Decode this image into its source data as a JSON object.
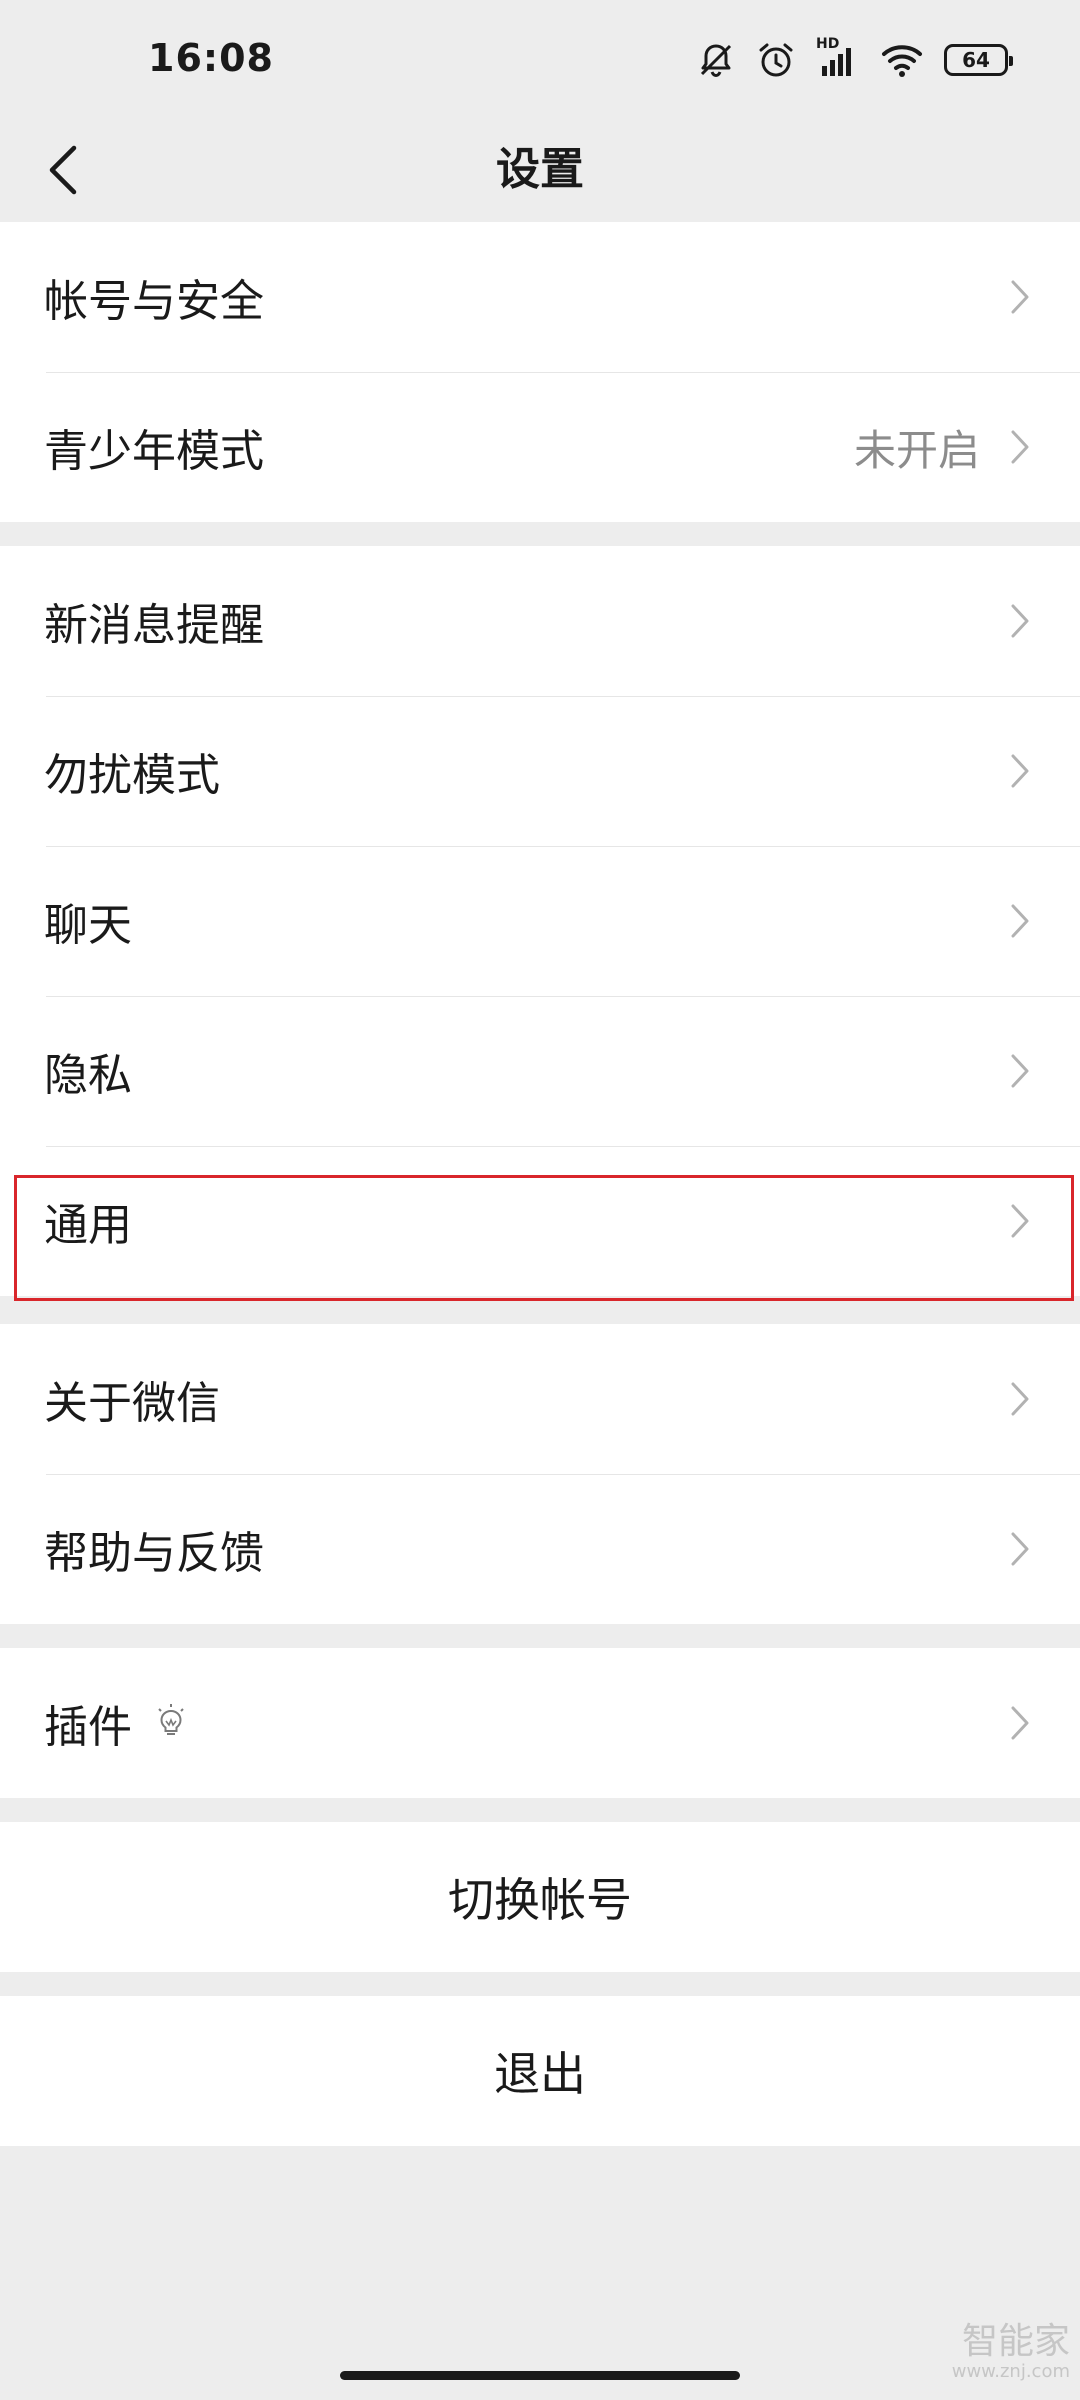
{
  "status_bar": {
    "time": "16:08",
    "signal_label": "HD",
    "battery": "64",
    "icons": [
      "bell-muted-icon",
      "alarm-icon",
      "signal-icon",
      "wifi-icon",
      "battery-icon"
    ]
  },
  "header": {
    "title": "设置",
    "back_icon": "chevron-left-icon"
  },
  "groups": [
    {
      "items": [
        {
          "label": "帐号与安全",
          "value": ""
        },
        {
          "label": "青少年模式",
          "value": "未开启"
        }
      ]
    },
    {
      "items": [
        {
          "label": "新消息提醒",
          "value": ""
        },
        {
          "label": "勿扰模式",
          "value": ""
        },
        {
          "label": "聊天",
          "value": ""
        },
        {
          "label": "隐私",
          "value": ""
        },
        {
          "label": "通用",
          "value": "",
          "highlighted": true
        }
      ]
    },
    {
      "items": [
        {
          "label": "关于微信",
          "value": ""
        },
        {
          "label": "帮助与反馈",
          "value": ""
        }
      ]
    },
    {
      "items": [
        {
          "label": "插件",
          "value": "",
          "icon": "lightbulb-icon"
        }
      ]
    }
  ],
  "actions": {
    "switch_account": "切换帐号",
    "logout": "退出"
  },
  "watermark": {
    "main": "智能家",
    "sub": "www.znj.com"
  },
  "colors": {
    "background": "#ededed",
    "row_background": "#ffffff",
    "secondary_text": "#8c8c8c",
    "highlight_border": "#d9262b"
  }
}
